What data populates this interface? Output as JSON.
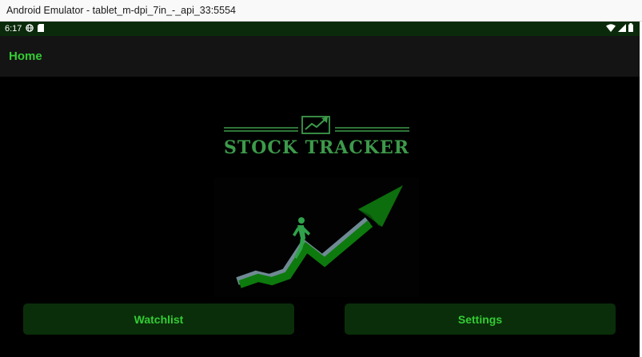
{
  "window": {
    "title": "Android Emulator - tablet_m-dpi_7in_-_api_33:5554"
  },
  "status_bar": {
    "time": "6:17",
    "left_icons": [
      "globe-icon",
      "sim-card-icon"
    ],
    "right_icons": [
      "wifi-icon",
      "signal-icon",
      "battery-icon"
    ]
  },
  "app_bar": {
    "title": "Home"
  },
  "logo": {
    "text": "STOCK TRACKER"
  },
  "buttons": {
    "watchlist": "Watchlist",
    "settings": "Settings"
  },
  "colors": {
    "accent": "#33cc33",
    "status_bar": "#0b2a0b",
    "app_bar": "#141414",
    "button_bg": "#0a2e0a",
    "logo": "#3d9a4a",
    "arrow": "#0d7a0d"
  }
}
